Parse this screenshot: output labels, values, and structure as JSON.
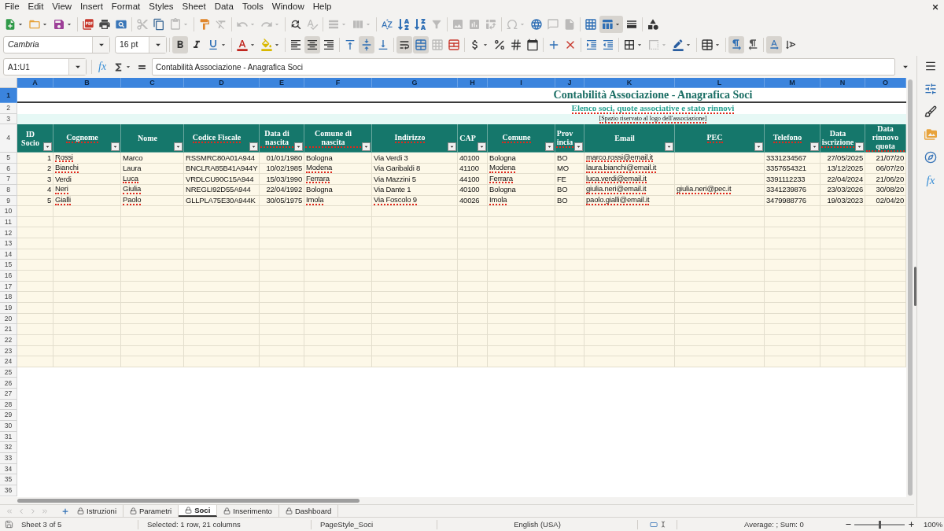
{
  "menu": [
    "File",
    "Edit",
    "View",
    "Insert",
    "Format",
    "Styles",
    "Sheet",
    "Data",
    "Tools",
    "Window",
    "Help"
  ],
  "standard_toolbar": [
    [
      {
        "kind": "new",
        "pressed": false,
        "disabled": false
      },
      {
        "kind": "open",
        "pressed": false,
        "disabled": false
      },
      {
        "kind": "save",
        "pressed": false,
        "disabled": false
      }
    ],
    [
      {
        "kind": "export_pdf",
        "pressed": false,
        "disabled": false
      },
      {
        "kind": "print",
        "pressed": false,
        "disabled": false
      },
      {
        "kind": "print_preview",
        "pressed": false,
        "disabled": false
      }
    ],
    [
      {
        "kind": "cut",
        "pressed": false,
        "disabled": true
      },
      {
        "kind": "copy",
        "pressed": false,
        "disabled": false
      },
      {
        "kind": "paste",
        "pressed": false,
        "disabled": true
      }
    ],
    [
      {
        "kind": "clone_formatting",
        "pressed": false,
        "disabled": false
      },
      {
        "kind": "clear_formatting",
        "pressed": false,
        "disabled": true
      }
    ],
    [
      {
        "kind": "undo",
        "pressed": false,
        "disabled": true
      },
      {
        "kind": "redo",
        "pressed": false,
        "disabled": true
      }
    ],
    [
      {
        "kind": "find_replace",
        "pressed": false,
        "disabled": false
      },
      {
        "kind": "spelling",
        "pressed": false,
        "disabled": true
      }
    ],
    [
      {
        "kind": "row",
        "pressed": false,
        "disabled": true
      },
      {
        "kind": "column",
        "pressed": false,
        "disabled": true
      }
    ],
    [
      {
        "kind": "sort",
        "pressed": false,
        "disabled": false
      },
      {
        "kind": "sort_ascending",
        "pressed": false,
        "disabled": false
      },
      {
        "kind": "sort_descending",
        "pressed": false,
        "disabled": false
      },
      {
        "kind": "autofilter",
        "pressed": false,
        "disabled": true
      }
    ],
    [
      {
        "kind": "image",
        "pressed": false,
        "disabled": true
      },
      {
        "kind": "chart",
        "pressed": false,
        "disabled": true
      },
      {
        "kind": "pivot_table",
        "pressed": false,
        "disabled": true
      }
    ],
    [
      {
        "kind": "special_character",
        "pressed": false,
        "disabled": true
      },
      {
        "kind": "hyperlink",
        "pressed": false,
        "disabled": false
      },
      {
        "kind": "comment",
        "pressed": false,
        "disabled": true
      },
      {
        "kind": "headers_footers",
        "pressed": false,
        "disabled": true
      }
    ],
    [
      {
        "kind": "print_area",
        "pressed": false,
        "disabled": false
      },
      {
        "kind": "freeze",
        "pressed": true,
        "disabled": false
      },
      {
        "kind": "split_window",
        "pressed": false,
        "disabled": false
      }
    ],
    [
      {
        "kind": "draw_functions",
        "pressed": false,
        "disabled": false
      }
    ]
  ],
  "formatting_toolbar": {
    "font_name": "Cambria",
    "font_size": "16 pt",
    "groups": [
      [
        {
          "kind": "bold",
          "pressed": true,
          "disabled": false
        },
        {
          "kind": "italic",
          "pressed": false,
          "disabled": false
        },
        {
          "kind": "underline",
          "pressed": false,
          "disabled": false
        }
      ],
      [
        {
          "kind": "font_color",
          "pressed": false,
          "disabled": false
        },
        {
          "kind": "highlight",
          "pressed": false,
          "disabled": false
        }
      ],
      [
        {
          "kind": "align_left",
          "pressed": false,
          "disabled": false
        },
        {
          "kind": "align_center",
          "pressed": true,
          "disabled": false
        },
        {
          "kind": "align_right",
          "pressed": false,
          "disabled": false
        }
      ],
      [
        {
          "kind": "align_top",
          "pressed": false,
          "disabled": false
        },
        {
          "kind": "align_middle",
          "pressed": true,
          "disabled": false
        },
        {
          "kind": "align_bottom",
          "pressed": false,
          "disabled": false
        }
      ],
      [
        {
          "kind": "wrap_text",
          "pressed": true,
          "disabled": false
        },
        {
          "kind": "merge_center",
          "pressed": true,
          "disabled": false
        },
        {
          "kind": "merge_cells",
          "pressed": false,
          "disabled": true
        },
        {
          "kind": "unmerge_cells",
          "pressed": false,
          "disabled": false
        }
      ],
      [
        {
          "kind": "currency",
          "pressed": false,
          "disabled": false
        },
        {
          "kind": "percent",
          "pressed": false,
          "disabled": false
        },
        {
          "kind": "number",
          "pressed": false,
          "disabled": false
        },
        {
          "kind": "date",
          "pressed": false,
          "disabled": false
        }
      ],
      [
        {
          "kind": "add_decimal",
          "pressed": false,
          "disabled": false
        },
        {
          "kind": "delete_decimal",
          "pressed": false,
          "disabled": false
        }
      ],
      [
        {
          "kind": "indent_increase",
          "pressed": false,
          "disabled": false
        },
        {
          "kind": "indent_decrease",
          "pressed": false,
          "disabled": false
        }
      ],
      [
        {
          "kind": "borders",
          "pressed": false,
          "disabled": false
        },
        {
          "kind": "border_style",
          "pressed": false,
          "disabled": true
        },
        {
          "kind": "border_color",
          "pressed": false,
          "disabled": false
        }
      ],
      [
        {
          "kind": "conditional",
          "pressed": false,
          "disabled": false
        }
      ],
      [
        {
          "kind": "left_to_right",
          "pressed": true,
          "disabled": false
        },
        {
          "kind": "right_to_left",
          "pressed": false,
          "disabled": false
        }
      ],
      [
        {
          "kind": "text_horizontal",
          "pressed": true,
          "disabled": false
        },
        {
          "kind": "text_vertical",
          "pressed": false,
          "disabled": false
        }
      ]
    ]
  },
  "formula_bar": {
    "name_box": "A1:U1",
    "function_wizard": "fx",
    "content": "Contabilità Associazione - Anagrafica Soci"
  },
  "sheet": {
    "columns": [
      {
        "letter": "A",
        "selected": true,
        "header": "ID Socio",
        "misspelled": false,
        "filter_button": true
      },
      {
        "letter": "B",
        "selected": true,
        "header": "Cognome",
        "misspelled": true,
        "filter_button": true
      },
      {
        "letter": "C",
        "selected": true,
        "header": "Nome",
        "misspelled": false,
        "filter_button": true
      },
      {
        "letter": "D",
        "selected": true,
        "header": "Codice Fiscale",
        "misspelled": true,
        "filter_button": true
      },
      {
        "letter": "E",
        "selected": true,
        "header": "Data di nascita",
        "misspelled": true,
        "filter_button": true
      },
      {
        "letter": "F",
        "selected": true,
        "header": "Comune di nascita",
        "misspelled": true,
        "filter_button": true
      },
      {
        "letter": "G",
        "selected": true,
        "header": "Indirizzo",
        "misspelled": true,
        "filter_button": true
      },
      {
        "letter": "H",
        "selected": true,
        "header": "CAP",
        "misspelled": false,
        "filter_button": true
      },
      {
        "letter": "I",
        "selected": true,
        "header": "Comune",
        "misspelled": true,
        "filter_button": true
      },
      {
        "letter": "J",
        "selected": true,
        "header": "Provincia",
        "misspelled": true,
        "filter_button": true
      },
      {
        "letter": "K",
        "selected": true,
        "header": "Email",
        "misspelled": false,
        "filter_button": true
      },
      {
        "letter": "L",
        "selected": true,
        "header": "PEC",
        "misspelled": true,
        "filter_button": true
      },
      {
        "letter": "M",
        "selected": true,
        "header": "Telefono",
        "misspelled": true,
        "filter_button": true
      },
      {
        "letter": "N",
        "selected": true,
        "header": "Data iscrizione",
        "misspelled": true,
        "filter_button": true
      },
      {
        "letter": "O",
        "selected": true,
        "header": "Data rinnovo quota",
        "misspelled": true,
        "filter_button": false
      }
    ],
    "row_numbers": [
      {
        "label": "1",
        "selected": true
      },
      {
        "label": "2",
        "selected": false
      },
      {
        "label": "3",
        "selected": false
      },
      {
        "label": "4",
        "selected": false
      },
      {
        "label": "5",
        "selected": false
      },
      {
        "label": "6",
        "selected": false
      },
      {
        "label": "7",
        "selected": false
      },
      {
        "label": "8",
        "selected": false
      },
      {
        "label": "9",
        "selected": false
      },
      {
        "label": "10",
        "selected": false
      },
      {
        "label": "11",
        "selected": false
      },
      {
        "label": "12",
        "selected": false
      },
      {
        "label": "13",
        "selected": false
      },
      {
        "label": "14",
        "selected": false
      },
      {
        "label": "15",
        "selected": false
      },
      {
        "label": "16",
        "selected": false
      },
      {
        "label": "17",
        "selected": false
      },
      {
        "label": "18",
        "selected": false
      },
      {
        "label": "19",
        "selected": false
      },
      {
        "label": "20",
        "selected": false
      },
      {
        "label": "21",
        "selected": false
      },
      {
        "label": "22",
        "selected": false
      },
      {
        "label": "23",
        "selected": false
      },
      {
        "label": "24",
        "selected": false
      },
      {
        "label": "25",
        "selected": false
      },
      {
        "label": "26",
        "selected": false
      },
      {
        "label": "27",
        "selected": false
      },
      {
        "label": "28",
        "selected": false
      },
      {
        "label": "29",
        "selected": false
      },
      {
        "label": "30",
        "selected": false
      },
      {
        "label": "31",
        "selected": false
      },
      {
        "label": "32",
        "selected": false
      },
      {
        "label": "33",
        "selected": false
      },
      {
        "label": "34",
        "selected": false
      },
      {
        "label": "35",
        "selected": false
      },
      {
        "label": "36",
        "selected": false
      }
    ],
    "title": {
      "text": "Contabilità Associazione - Anagrafica Soci",
      "misspelled": false
    },
    "subtitle": {
      "text": "Elenco soci, quote associative e stato rinnovi",
      "misspelled": true
    },
    "logo_note": {
      "text": "[Spazio riservato al logo dell'associazione]",
      "misspelled": true
    },
    "rows": [
      {
        "cells": {
          "A": {
            "text": "1",
            "misspelled": false
          },
          "B": {
            "text": "Rossi",
            "misspelled": true
          },
          "C": {
            "text": "Marco",
            "misspelled": false
          },
          "D": {
            "text": "RSSMRC80A01A944",
            "misspelled": false
          },
          "E": {
            "text": "01/01/1980",
            "misspelled": false
          },
          "F": {
            "text": "Bologna",
            "misspelled": false
          },
          "G": {
            "text": "Via Verdi 3",
            "misspelled": false
          },
          "H": {
            "text": "40100",
            "misspelled": false
          },
          "I": {
            "text": "Bologna",
            "misspelled": false
          },
          "J": {
            "text": "BO",
            "misspelled": false
          },
          "K": {
            "text": "marco.rossi@email.it",
            "misspelled": true
          },
          "M": {
            "text": "3331234567",
            "misspelled": false
          },
          "N": {
            "text": "27/05/2025",
            "misspelled": false
          },
          "O": {
            "text": "21/07/20",
            "misspelled": false
          }
        }
      },
      {
        "cells": {
          "A": {
            "text": "2",
            "misspelled": false
          },
          "B": {
            "text": "Bianchi",
            "misspelled": true
          },
          "C": {
            "text": "Laura",
            "misspelled": false
          },
          "D": {
            "text": "BNCLRA85B41A944Y",
            "misspelled": false
          },
          "E": {
            "text": "10/02/1985",
            "misspelled": false
          },
          "F": {
            "text": "Modena",
            "misspelled": true
          },
          "G": {
            "text": "Via Garibaldi 8",
            "misspelled": false
          },
          "H": {
            "text": "41100",
            "misspelled": false
          },
          "I": {
            "text": "Modena",
            "misspelled": true
          },
          "J": {
            "text": "MO",
            "misspelled": false
          },
          "K": {
            "text": "laura.bianchi@email.it",
            "misspelled": true
          },
          "M": {
            "text": "3357654321",
            "misspelled": false
          },
          "N": {
            "text": "13/12/2025",
            "misspelled": false
          },
          "O": {
            "text": "06/07/20",
            "misspelled": false
          }
        }
      },
      {
        "cells": {
          "A": {
            "text": "3",
            "misspelled": false
          },
          "B": {
            "text": "Verdi",
            "misspelled": false
          },
          "C": {
            "text": "Luca",
            "misspelled": true
          },
          "D": {
            "text": "VRDLCU90C15A944",
            "misspelled": false
          },
          "E": {
            "text": "15/03/1990",
            "misspelled": false
          },
          "F": {
            "text": "Ferrara",
            "misspelled": true
          },
          "G": {
            "text": "Via Mazzini 5",
            "misspelled": false
          },
          "H": {
            "text": "44100",
            "misspelled": false
          },
          "I": {
            "text": "Ferrara",
            "misspelled": true
          },
          "J": {
            "text": "FE",
            "misspelled": false
          },
          "K": {
            "text": "luca.verdi@email.it",
            "misspelled": true
          },
          "M": {
            "text": "3391112233",
            "misspelled": false
          },
          "N": {
            "text": "22/04/2024",
            "misspelled": false
          },
          "O": {
            "text": "21/06/20",
            "misspelled": false
          }
        }
      },
      {
        "cells": {
          "A": {
            "text": "4",
            "misspelled": false
          },
          "B": {
            "text": "Neri",
            "misspelled": true
          },
          "C": {
            "text": "Giulia",
            "misspelled": true
          },
          "D": {
            "text": "NREGLI92D55A944",
            "misspelled": false
          },
          "E": {
            "text": "22/04/1992",
            "misspelled": false
          },
          "F": {
            "text": "Bologna",
            "misspelled": false
          },
          "G": {
            "text": "Via Dante 1",
            "misspelled": false
          },
          "H": {
            "text": "40100",
            "misspelled": false
          },
          "I": {
            "text": "Bologna",
            "misspelled": false
          },
          "J": {
            "text": "BO",
            "misspelled": false
          },
          "K": {
            "text": "giulia.neri@email.it",
            "misspelled": true
          },
          "L": {
            "text": "giulia.neri@pec.it",
            "misspelled": true
          },
          "M": {
            "text": "3341239876",
            "misspelled": false
          },
          "N": {
            "text": "23/03/2026",
            "misspelled": false
          },
          "O": {
            "text": "30/08/20",
            "misspelled": false
          }
        }
      },
      {
        "cells": {
          "A": {
            "text": "5",
            "misspelled": false
          },
          "B": {
            "text": "Gialli",
            "misspelled": true
          },
          "C": {
            "text": "Paolo",
            "misspelled": true
          },
          "D": {
            "text": "GLLPLA75E30A944K",
            "misspelled": false
          },
          "E": {
            "text": "30/05/1975",
            "misspelled": false
          },
          "F": {
            "text": "Imola",
            "misspelled": true
          },
          "G": {
            "text": "Via Foscolo 9",
            "misspelled": true
          },
          "H": {
            "text": "40026",
            "misspelled": false
          },
          "I": {
            "text": "Imola",
            "misspelled": true
          },
          "J": {
            "text": "BO",
            "misspelled": false
          },
          "K": {
            "text": "paolo.gialli@email.it",
            "misspelled": true
          },
          "M": {
            "text": "3479988776",
            "misspelled": false
          },
          "N": {
            "text": "19/03/2023",
            "misspelled": false
          },
          "O": {
            "text": "02/04/20",
            "misspelled": false
          }
        }
      }
    ]
  },
  "sheet_tabs": {
    "navigation_disabled": true,
    "tabs": [
      {
        "label": "Istruzioni",
        "selected": false,
        "locked": true
      },
      {
        "label": "Parametri",
        "selected": false,
        "locked": true
      },
      {
        "label": "Soci",
        "selected": true,
        "locked": true
      },
      {
        "label": "Inserimento",
        "selected": false,
        "locked": true
      },
      {
        "label": "Dashboard",
        "selected": false,
        "locked": true
      }
    ]
  },
  "sidebar": {
    "functions_label": "fx"
  },
  "status_bar": {
    "sheet": "Sheet 3 of 5",
    "selection": "Selected: 1 row, 21 columns",
    "page_style": "PageStyle_Soci",
    "language": "English (USA)",
    "sum": "Average: ; Sum: 0",
    "zoom": {
      "level": 0.5,
      "reading": "100%"
    }
  }
}
